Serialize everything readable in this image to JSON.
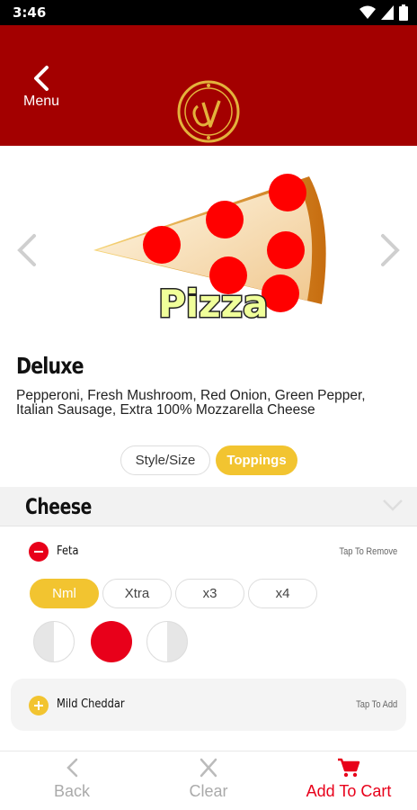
{
  "status": {
    "time": "3:46"
  },
  "header": {
    "back_label": "Menu"
  },
  "item": {
    "image_text": "Pizza",
    "name": "Deluxe",
    "description": "Pepperoni, Fresh Mushroom, Red Onion, Green Pepper, Italian Sausage, Extra 100% Mozzarella Cheese"
  },
  "segments": [
    {
      "label": "Style/Size",
      "selected": false
    },
    {
      "label": "Toppings",
      "selected": true
    }
  ],
  "section": {
    "title": "Cheese"
  },
  "toppings": [
    {
      "name": "Feta",
      "hint": "Tap To Remove",
      "amounts": [
        "Nml",
        "Xtra",
        "x3",
        "x4"
      ],
      "selected_amount": "Nml",
      "portion": "whole"
    },
    {
      "name": "Mild Cheddar",
      "hint": "Tap To Add"
    }
  ],
  "bottom": {
    "back": "Back",
    "clear": "Clear",
    "add": "Add To Cart"
  },
  "colors": {
    "brand": "#a30000",
    "accent": "#f2c430",
    "action": "#e8001a"
  }
}
